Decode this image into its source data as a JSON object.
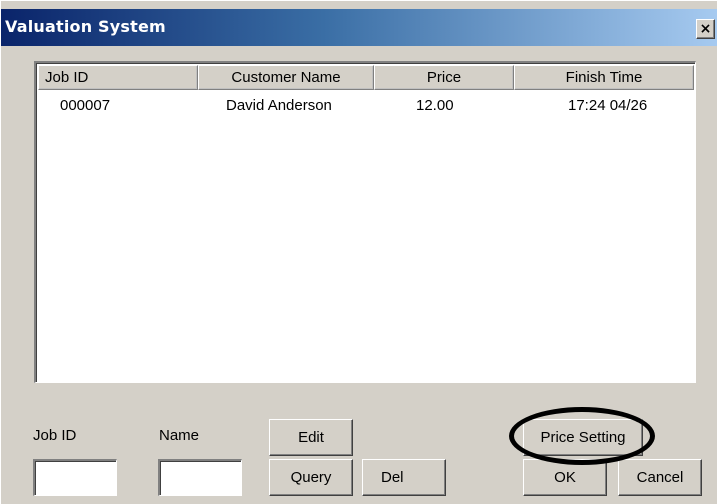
{
  "window": {
    "title": "Valuation System",
    "close_label": "×"
  },
  "table": {
    "columns": [
      "Job ID",
      "Customer Name",
      "Price",
      "Finish Time"
    ],
    "rows": [
      {
        "job_id": "000007",
        "customer_name": "David Anderson",
        "price": "12.00",
        "finish_time": "17:24 04/26"
      }
    ]
  },
  "form": {
    "job_id_label": "Job ID",
    "job_id_value": "",
    "name_label": "Name",
    "name_value": ""
  },
  "buttons": {
    "edit": "Edit",
    "query": "Query",
    "del": "Del",
    "price_setting": "Price Setting",
    "ok": "OK",
    "cancel": "Cancel"
  },
  "annotation": {
    "highlighted": "price-setting-button",
    "color": "#000000"
  }
}
